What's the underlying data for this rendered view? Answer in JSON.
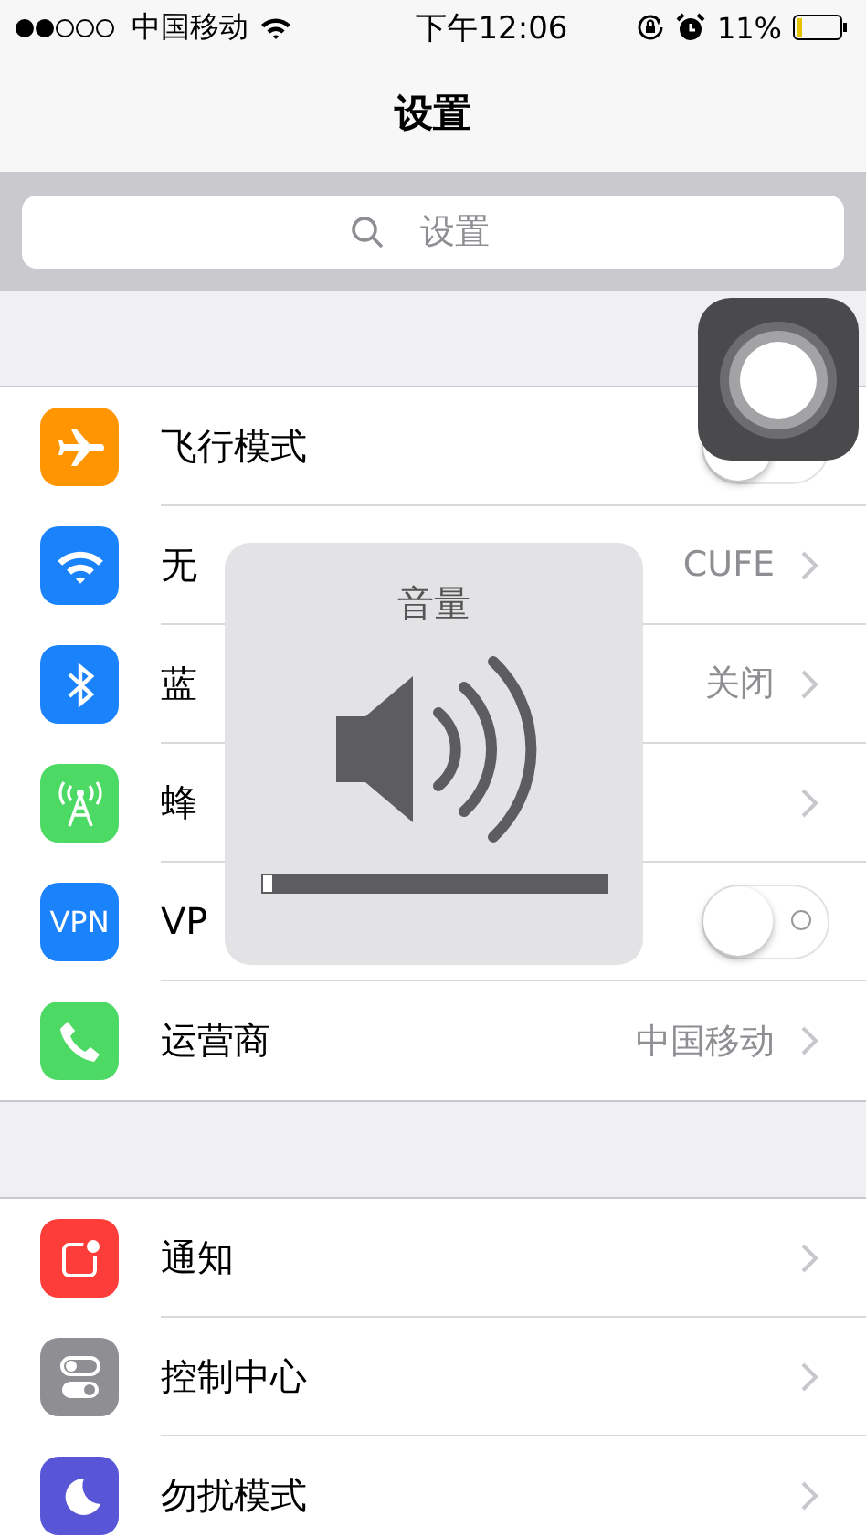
{
  "status_bar": {
    "carrier": "中国移动",
    "time": "下午12:06",
    "battery_text": "11%"
  },
  "nav": {
    "title": "设置"
  },
  "search": {
    "placeholder": "设置"
  },
  "groups": [
    {
      "rows": [
        {
          "label": "飞行模式",
          "color": "#ff9500",
          "kind": "toggle",
          "on": false
        },
        {
          "label": "无",
          "color": "#1a82fb",
          "kind": "chevron",
          "value": "CUFE"
        },
        {
          "label": "蓝",
          "color": "#1a82fb",
          "kind": "chevron",
          "value": "关闭"
        },
        {
          "label": "蜂",
          "color": "#4cd964",
          "kind": "chevron"
        },
        {
          "label": "VP",
          "color": "#1a82fb",
          "kind": "toggle",
          "on": false,
          "icon_text": "VPN"
        },
        {
          "label": "运营商",
          "color": "#4cd964",
          "kind": "chevron",
          "value": "中国移动"
        }
      ]
    },
    {
      "rows": [
        {
          "label": "通知",
          "color": "#fc3d39",
          "kind": "chevron"
        },
        {
          "label": "控制中心",
          "color": "#8e8e93",
          "kind": "chevron"
        },
        {
          "label": "勿扰模式",
          "color": "#5856d6",
          "kind": "chevron"
        }
      ]
    }
  ],
  "volume_hud": {
    "title": "音量",
    "level": 0.03
  }
}
